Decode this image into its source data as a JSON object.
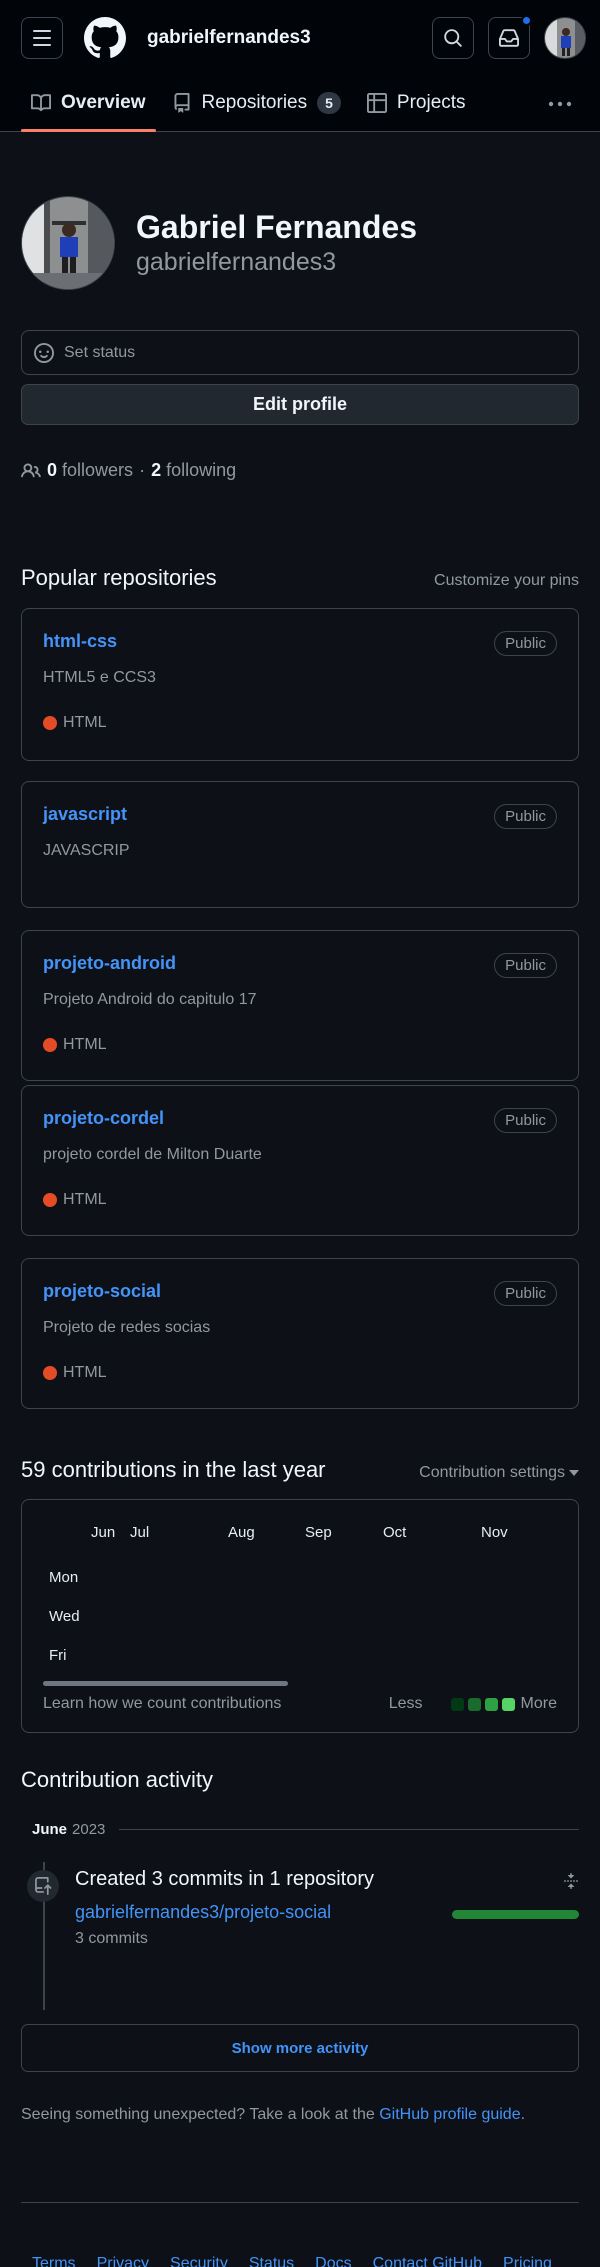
{
  "header": {
    "title": "gabrielfernandes3",
    "icons": [
      "hamburger-icon",
      "github-logo",
      "search-icon",
      "inbox-icon",
      "avatar"
    ]
  },
  "tabs": [
    {
      "label": "Overview",
      "icon": "book-icon",
      "active": true
    },
    {
      "label": "Repositories",
      "icon": "repo-icon",
      "count": "5"
    },
    {
      "label": "Projects",
      "icon": "table-icon"
    }
  ],
  "profile": {
    "full_name": "Gabriel Fernandes",
    "username": "gabrielfernandes3",
    "set_status": "Set status",
    "edit_profile": "Edit profile",
    "followers_count": "0",
    "followers_label": "followers",
    "following_count": "2",
    "following_label": "following"
  },
  "popular": {
    "title": "Popular repositories",
    "customize": "Customize your pins",
    "repos": [
      {
        "name": "html-css",
        "badge": "Public",
        "description": "HTML5 e CCS3",
        "language": "HTML"
      },
      {
        "name": "javascript",
        "badge": "Public",
        "description": "JAVASCRIP",
        "language": ""
      },
      {
        "name": "projeto-android",
        "badge": "Public",
        "description": "Projeto Android do capitulo 17",
        "language": "HTML"
      },
      {
        "name": "projeto-cordel",
        "badge": "Public",
        "description": "projeto cordel de Milton Duarte",
        "language": "HTML"
      },
      {
        "name": "projeto-social",
        "badge": "Public",
        "description": "Projeto de redes socias",
        "language": "HTML"
      }
    ]
  },
  "contributions": {
    "title": "59 contributions in the last year",
    "settings": "Contribution settings",
    "months": [
      "Jun",
      "Jul",
      "Aug",
      "Sep",
      "Oct",
      "Nov"
    ],
    "days": [
      "Mon",
      "Wed",
      "Fri"
    ],
    "learn": "Learn how we count contributions",
    "less": "Less",
    "more": "More",
    "legend_colors": [
      "#033a16",
      "#196c2e",
      "#2ea043",
      "#56d364"
    ]
  },
  "activity": {
    "title": "Contribution activity",
    "month": "June",
    "year": "2023",
    "item_title": "Created 3 commits in 1 repository",
    "item_repo": "gabrielfernandes3/projeto-social",
    "item_commits": "3 commits",
    "show_more": "Show more activity",
    "unexpected_text": "Seeing something unexpected? Take a look at the",
    "guide_link": "GitHub profile guide",
    "period": "."
  },
  "footer": {
    "links": [
      "Terms",
      "Privacy",
      "Security",
      "Status",
      "Docs",
      "Contact GitHub",
      "Pricing"
    ]
  }
}
